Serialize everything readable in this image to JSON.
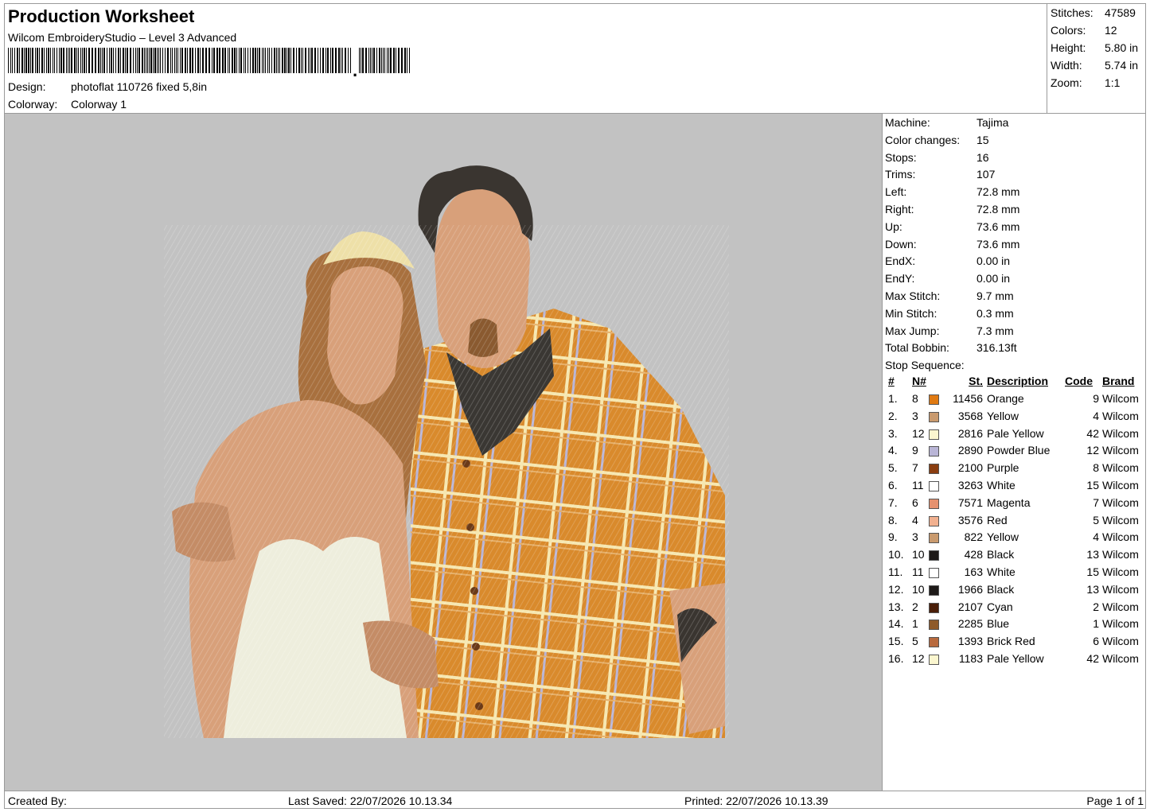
{
  "header": {
    "title": "Production Worksheet",
    "software": "Wilcom EmbroideryStudio – Level 3 Advanced",
    "design_label": "Design:",
    "design_value": "photoflat 110726 fixed 5,8in",
    "colorway_label": "Colorway:",
    "colorway_value": "Colorway 1"
  },
  "summary": [
    {
      "label": "Stitches:",
      "value": "47589"
    },
    {
      "label": "Colors:",
      "value": "12"
    },
    {
      "label": "Height:",
      "value": "5.80 in"
    },
    {
      "label": "Width:",
      "value": "5.74 in"
    },
    {
      "label": "Zoom:",
      "value": "1:1"
    }
  ],
  "machine_info": [
    {
      "label": "Machine:",
      "value": "Tajima"
    },
    {
      "label": "Color changes:",
      "value": "15"
    },
    {
      "label": "Stops:",
      "value": "16"
    },
    {
      "label": "Trims:",
      "value": "107"
    },
    {
      "label": "Left:",
      "value": "72.8 mm"
    },
    {
      "label": "Right:",
      "value": "72.8 mm"
    },
    {
      "label": "Up:",
      "value": "73.6 mm"
    },
    {
      "label": "Down:",
      "value": "73.6 mm"
    },
    {
      "label": "EndX:",
      "value": "0.00 in"
    },
    {
      "label": "EndY:",
      "value": "0.00 in"
    },
    {
      "label": "Max Stitch:",
      "value": "9.7 mm"
    },
    {
      "label": "Min Stitch:",
      "value": "0.3 mm"
    },
    {
      "label": "Max Jump:",
      "value": "7.3 mm"
    },
    {
      "label": "Total Bobbin:",
      "value": "316.13ft"
    },
    {
      "label": "Stop Sequence:",
      "value": ""
    }
  ],
  "table": {
    "headers": {
      "num": "#",
      "n": "N#",
      "st": "St.",
      "desc": "Description",
      "code": "Code",
      "brand": "Brand"
    },
    "rows": [
      {
        "num": "1.",
        "n": "8",
        "st": "11456",
        "desc": "Orange",
        "code": "9",
        "brand": "Wilcom",
        "color": "#e07a12"
      },
      {
        "num": "2.",
        "n": "3",
        "st": "3568",
        "desc": "Yellow",
        "code": "4",
        "brand": "Wilcom",
        "color": "#c99a6e"
      },
      {
        "num": "3.",
        "n": "12",
        "st": "2816",
        "desc": "Pale Yellow",
        "code": "42",
        "brand": "Wilcom",
        "color": "#fbf6cf"
      },
      {
        "num": "4.",
        "n": "9",
        "st": "2890",
        "desc": "Powder Blue",
        "code": "12",
        "brand": "Wilcom",
        "color": "#b9b5d6"
      },
      {
        "num": "5.",
        "n": "7",
        "st": "2100",
        "desc": "Purple",
        "code": "8",
        "brand": "Wilcom",
        "color": "#8a3d10"
      },
      {
        "num": "6.",
        "n": "11",
        "st": "3263",
        "desc": "White",
        "code": "15",
        "brand": "Wilcom",
        "color": "#ffffff"
      },
      {
        "num": "7.",
        "n": "6",
        "st": "7571",
        "desc": "Magenta",
        "code": "7",
        "brand": "Wilcom",
        "color": "#e5916f"
      },
      {
        "num": "8.",
        "n": "4",
        "st": "3576",
        "desc": "Red",
        "code": "5",
        "brand": "Wilcom",
        "color": "#f1b08f"
      },
      {
        "num": "9.",
        "n": "3",
        "st": "822",
        "desc": "Yellow",
        "code": "4",
        "brand": "Wilcom",
        "color": "#c99a6e"
      },
      {
        "num": "10.",
        "n": "10",
        "st": "428",
        "desc": "Black",
        "code": "13",
        "brand": "Wilcom",
        "color": "#1e1a18"
      },
      {
        "num": "11.",
        "n": "11",
        "st": "163",
        "desc": "White",
        "code": "15",
        "brand": "Wilcom",
        "color": "#ffffff"
      },
      {
        "num": "12.",
        "n": "10",
        "st": "1966",
        "desc": "Black",
        "code": "13",
        "brand": "Wilcom",
        "color": "#1e1a18"
      },
      {
        "num": "13.",
        "n": "2",
        "st": "2107",
        "desc": "Cyan",
        "code": "2",
        "brand": "Wilcom",
        "color": "#4a1e08"
      },
      {
        "num": "14.",
        "n": "1",
        "st": "2285",
        "desc": "Blue",
        "code": "1",
        "brand": "Wilcom",
        "color": "#8e5a2a"
      },
      {
        "num": "15.",
        "n": "5",
        "st": "1393",
        "desc": "Brick Red",
        "code": "6",
        "brand": "Wilcom",
        "color": "#b86a3e"
      },
      {
        "num": "16.",
        "n": "12",
        "st": "1183",
        "desc": "Pale Yellow",
        "code": "42",
        "brand": "Wilcom",
        "color": "#fbf6cf"
      }
    ]
  },
  "footer": {
    "created_by": "Created By:",
    "last_saved": "Last Saved: 22/07/2026 10.13.34",
    "printed": "Printed: 22/07/2026 10.13.39",
    "page": "Page 1 of 1"
  },
  "colors": {
    "canvas_bg": "#c2c2c2",
    "shirt": "#d98a2c",
    "skin": "#d8a07a",
    "hair_dark": "#3a3530",
    "hair_brown": "#a8703e",
    "dress": "#eeeedd"
  }
}
